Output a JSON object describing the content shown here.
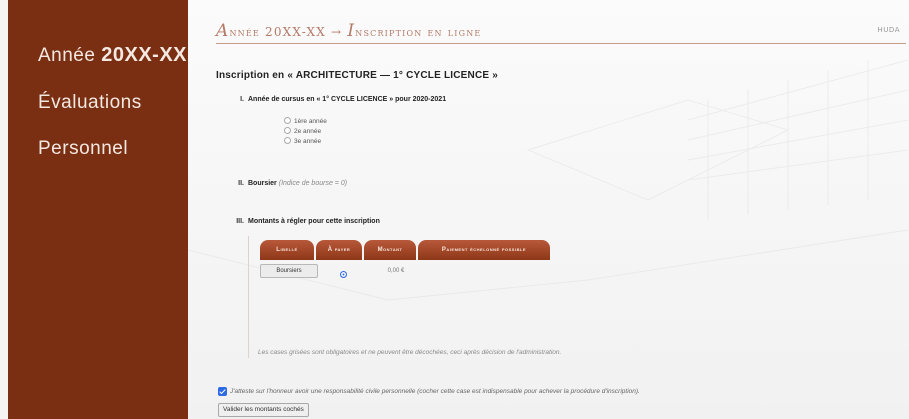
{
  "sidebar": {
    "items": [
      {
        "label_prefix": "Année ",
        "label_year": "20XX-XX"
      },
      {
        "label": "Évaluations"
      },
      {
        "label": "Personnel"
      }
    ]
  },
  "topbar": {
    "crumb_first_initial": "A",
    "crumb_first_rest": "nnée 20XX-XX",
    "crumb_arrow": " → ",
    "crumb_second_initial": "I",
    "crumb_second_rest": "nscription en ligne",
    "right_text": "HUDA"
  },
  "heading": "Inscription en « ARCHITECTURE — 1° CYCLE LICENCE »",
  "section1": {
    "num": "I.",
    "title": "Année de cursus en « 1° CYCLE LICENCE » pour 2020-2021",
    "options": [
      {
        "label": "1ère année",
        "selected": false
      },
      {
        "label": "2e année",
        "selected": false
      },
      {
        "label": "3e année",
        "selected": false
      }
    ]
  },
  "section2": {
    "num": "II.",
    "title": "Boursier",
    "note": "(Indice de bourse = 0)"
  },
  "section3": {
    "num": "III.",
    "title": "Montants à régler pour cette inscription",
    "columns": [
      "Libellé",
      "À payer",
      "Montant",
      "Paiement échelonné possible"
    ],
    "rows": [
      {
        "libelle": "Boursiers",
        "a_payer": true,
        "montant": "0,00 €"
      }
    ],
    "footnote": "Les cases grisées sont obligatoires et ne peuvent être décochées, ceci après décision de l'administration."
  },
  "honor": {
    "checked": true,
    "text": "J'atteste sur l'honneur avoir une responsabilité civile personnelle (cocher cette case est indispensable pour achever la procédure d'inscription)."
  },
  "validate_label": "Valider les montants cochés",
  "colors": {
    "sidebar": "#7a2e12",
    "accent": "#b47a67",
    "table_header": "#9a4322",
    "check_blue": "#2f6ae6"
  }
}
